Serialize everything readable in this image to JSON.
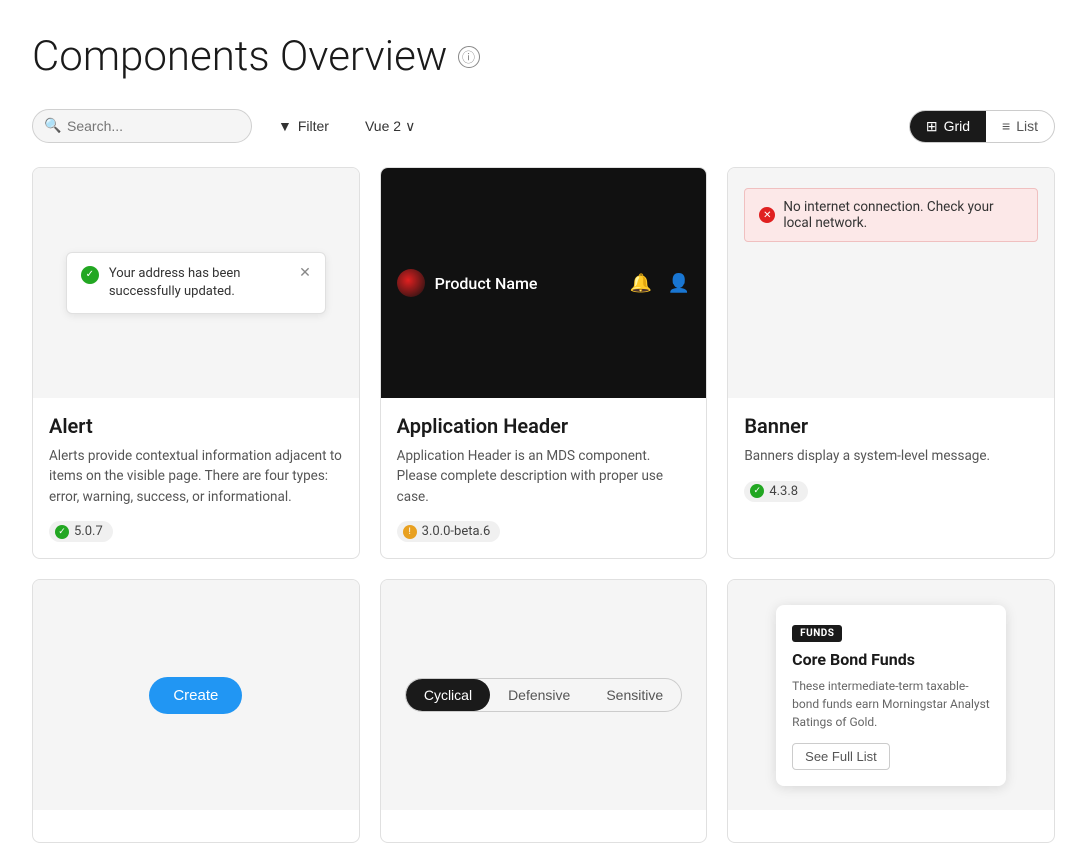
{
  "page": {
    "title": "Components Overview",
    "info_icon": "ⓘ"
  },
  "toolbar": {
    "search_placeholder": "Search...",
    "filter_label": "Filter",
    "vue_label": "Vue 2",
    "grid_label": "Grid",
    "list_label": "List"
  },
  "cards": [
    {
      "id": "alert",
      "title": "Alert",
      "description": "Alerts provide contextual information adjacent to items on the visible page. There are four types: error, warning, success, or informational.",
      "version": "5.0.7",
      "version_type": "stable",
      "preview_type": "alert"
    },
    {
      "id": "application-header",
      "title": "Application Header",
      "description": "Application Header is an MDS component. Please complete description with proper use case.",
      "version": "3.0.0-beta.6",
      "version_type": "beta",
      "preview_type": "app-header"
    },
    {
      "id": "banner",
      "title": "Banner",
      "description": "Banners display a system-level message.",
      "version": "4.3.8",
      "version_type": "stable",
      "preview_type": "banner"
    },
    {
      "id": "button",
      "title": "",
      "description": "",
      "version": "",
      "version_type": "",
      "preview_type": "create-button"
    },
    {
      "id": "segmented-control",
      "title": "",
      "description": "",
      "version": "",
      "version_type": "",
      "preview_type": "segmented-control"
    },
    {
      "id": "fund-card",
      "title": "",
      "description": "",
      "version": "",
      "version_type": "",
      "preview_type": "fund-card"
    }
  ],
  "previews": {
    "alert": {
      "message": "Your address has been successfully updated."
    },
    "app_header": {
      "product_name": "Product Name"
    },
    "banner": {
      "message": "No internet connection. Check your local network."
    },
    "create_button": {
      "label": "Create"
    },
    "segmented": {
      "options": [
        "Cyclical",
        "Defensive",
        "Sensitive"
      ],
      "active": "Cyclical"
    },
    "fund": {
      "tag": "FUNDS",
      "title": "Core Bond Funds",
      "description": "These intermediate-term taxable-bond funds earn Morningstar Analyst Ratings of Gold.",
      "link_label": "See Full List"
    }
  }
}
